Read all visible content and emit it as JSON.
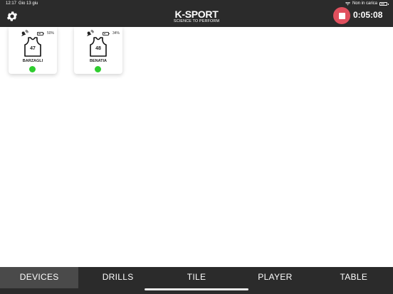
{
  "status_bar": {
    "time": "12:17",
    "date": "Gio 13 giu",
    "charging_text": "Non in carica"
  },
  "header": {
    "logo_main": "K-SPORT",
    "logo_sub": "SCIENCE TO PERFORM",
    "timer": "0:05:08",
    "colors": {
      "bar": "#2b2b2b",
      "stop": "#e0505e"
    }
  },
  "devices": [
    {
      "battery_pct": "50%",
      "battery_level": 0.5,
      "number": "47",
      "name": "BARZAGLI",
      "status_color": "#2ecc2e"
    },
    {
      "battery_pct": "34%",
      "battery_level": 0.34,
      "number": "48",
      "name": "BENATIA",
      "status_color": "#2ecc2e"
    }
  ],
  "tabs": [
    {
      "label": "DEVICES",
      "active": true
    },
    {
      "label": "DRILLS",
      "active": false
    },
    {
      "label": "TILE",
      "active": false
    },
    {
      "label": "PLAYER",
      "active": false
    },
    {
      "label": "TABLE",
      "active": false
    }
  ]
}
